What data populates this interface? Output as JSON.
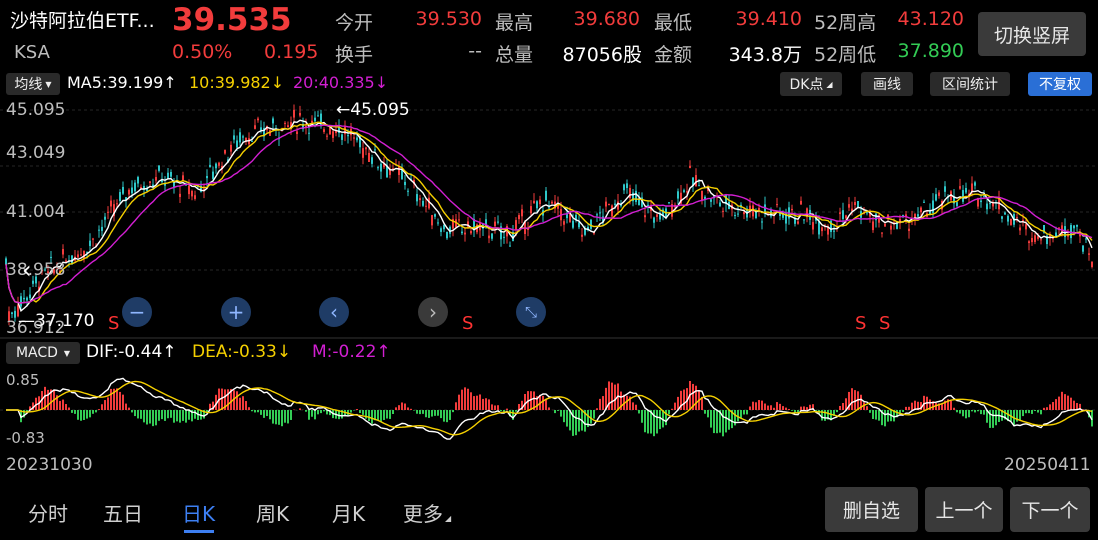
{
  "header": {
    "name": "沙特阿拉伯ETF...",
    "code": "KSA",
    "price": "39.535",
    "change_pct": "0.50%",
    "change_amt": "0.195",
    "stats": [
      {
        "label": "今开",
        "value": "39.530"
      },
      {
        "label": "最高",
        "value": "39.680"
      },
      {
        "label": "最低",
        "value": "39.410"
      },
      {
        "label": "52周高",
        "value": "43.120"
      },
      {
        "label": "换手",
        "value": "--"
      },
      {
        "label": "总量",
        "value": "87056股"
      },
      {
        "label": "金额",
        "value": "343.8万"
      },
      {
        "label": "52周低",
        "value": "37.890"
      }
    ],
    "switch_label": "切换竖屏"
  },
  "toolbar": {
    "avg_label": "均线",
    "ma5": "MA5:39.199↑",
    "ma10": "10:39.982↓",
    "ma20": "20:40.335↓",
    "dk_label": "DK点",
    "draw_label": "画线",
    "range_label": "区间统计",
    "adjust_label": "不复权"
  },
  "kline": {
    "y_ticks": [
      "45.095",
      "43.049",
      "41.004",
      "38.958",
      "36.912"
    ],
    "max_label": "45.095",
    "min_label": "37.170",
    "s_marks": [
      "S",
      "S",
      "S",
      "S"
    ]
  },
  "macd": {
    "select_label": "MACD",
    "dif": "DIF:-0.44↑",
    "dea": "DEA:-0.33↓",
    "m": "M:-0.22↑",
    "top": "0.85",
    "bottom": "-0.83"
  },
  "dates": {
    "start": "20231030",
    "end": "20250411"
  },
  "tabs": [
    "分时",
    "五日",
    "日K",
    "周K",
    "月K",
    "更多"
  ],
  "actions": {
    "remove": "删自选",
    "prev": "上一个",
    "next": "下一个"
  },
  "colors": {
    "up": "#f23c3c",
    "down": "#33cc55",
    "ma5": "#ffffff",
    "ma10": "#f5d000",
    "ma20": "#d21fd2",
    "accent": "#3d7ff2"
  }
}
